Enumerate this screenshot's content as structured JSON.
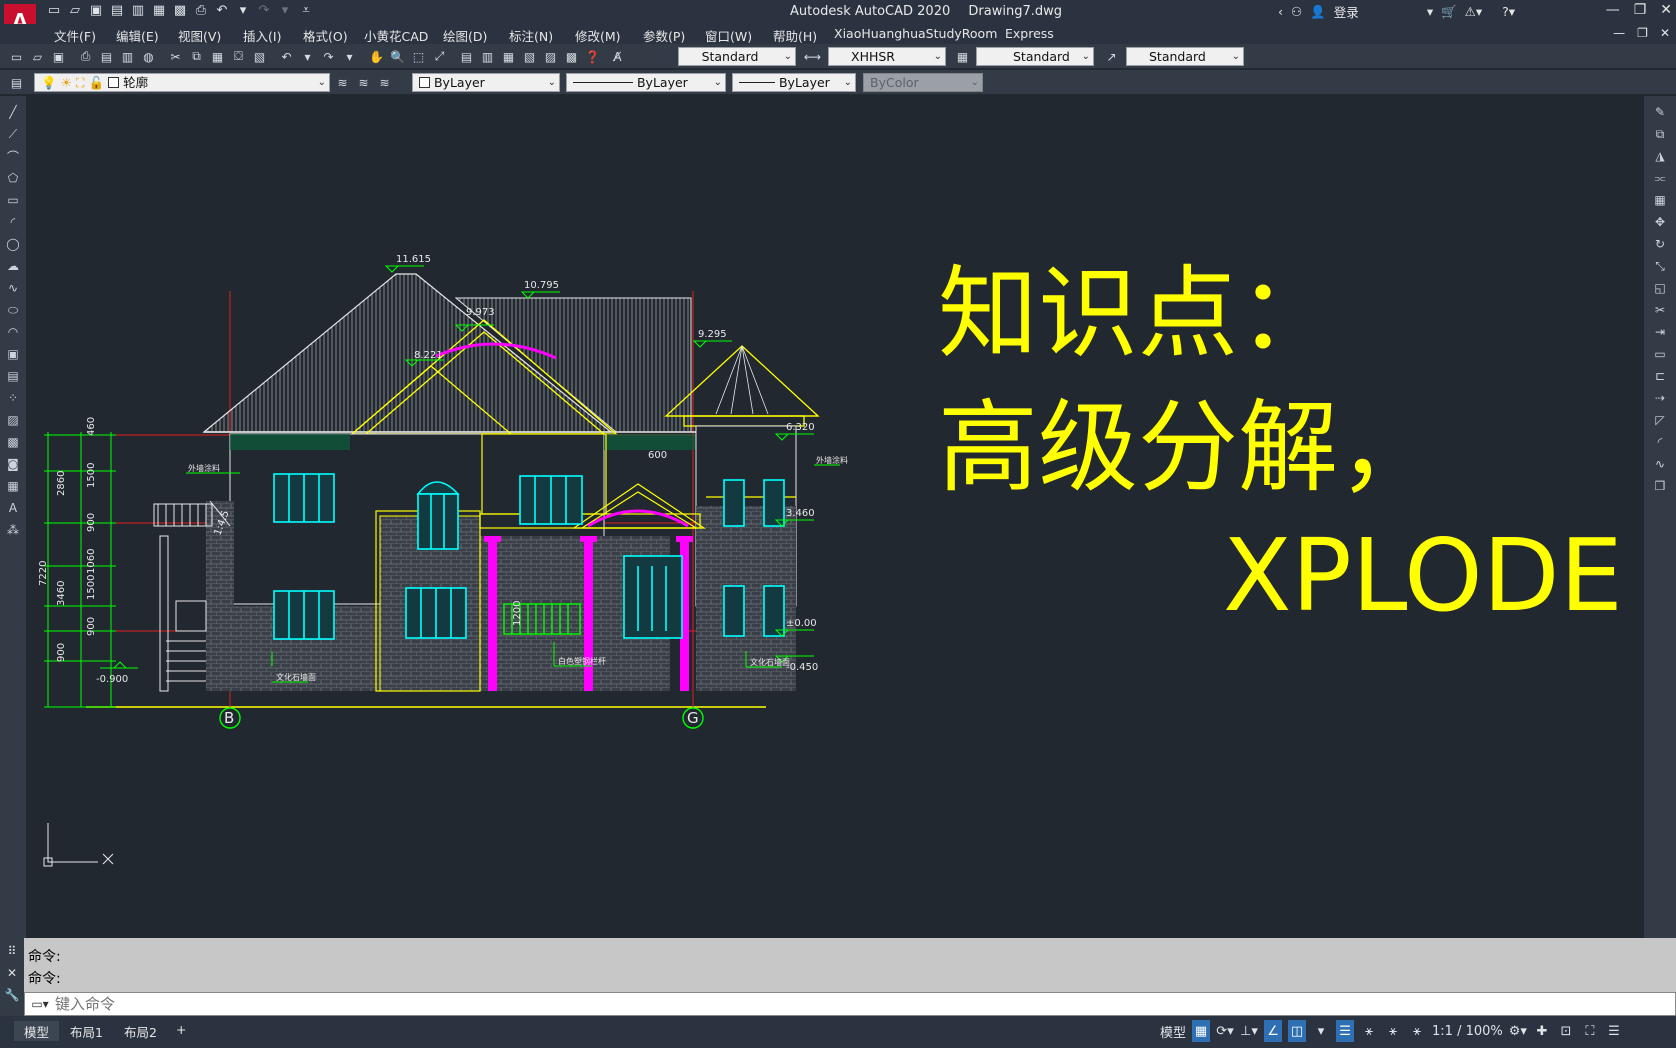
{
  "app": {
    "title": "Autodesk AutoCAD 2020",
    "file": "Drawing7.dwg",
    "logo": "A"
  },
  "top_right": {
    "signin": "登录"
  },
  "menu": [
    "文件(F)",
    "编辑(E)",
    "视图(V)",
    "插入(I)",
    "格式(O)",
    "小黄花CAD",
    "绘图(D)",
    "标注(N)",
    "修改(M)",
    "参数(P)",
    "窗口(W)",
    "帮助(H)",
    "XiaoHuanghuaStudyRoom",
    "Express"
  ],
  "styles_toolbar": {
    "text_style": "Standard",
    "dim_style": "XHHSR",
    "table_style": "Standard",
    "mleader_style": "Standard"
  },
  "layer_toolbar": {
    "layer": "轮廓",
    "color": "ByLayer",
    "linetype": "ByLayer",
    "lineweight": "ByLayer",
    "plotstyle": "ByColor"
  },
  "drawing": {
    "elevations": [
      "11.615",
      "10.795",
      "9.973",
      "9.295",
      "8.221",
      "6.320",
      "3.460",
      "±0.00",
      "-0.450",
      "-0.900"
    ],
    "dims_left": [
      "460",
      "2860",
      "1500",
      "900",
      "1060",
      "1500",
      "3460",
      "900",
      "900",
      "7220"
    ],
    "dim_600": "600",
    "dim_1200": "1200",
    "dim_skew": "1:4.5",
    "axes": [
      "B",
      "G"
    ],
    "labels": [
      "文化石墙面",
      "白色塑钢栏杆",
      "文化石墙面",
      "外墙涂料",
      "外墙涂料"
    ]
  },
  "overlay": {
    "line1": "知识点：",
    "line2": "高级分解，",
    "line3": "XPLODE"
  },
  "command": {
    "history": [
      "命令:",
      "命令:"
    ],
    "placeholder": "键入命令"
  },
  "layout_tabs": [
    "模型",
    "布局1",
    "布局2",
    "+"
  ],
  "status": {
    "model": "模型",
    "scale": "1:1 / 100%"
  },
  "colors": {
    "background": "#212830",
    "overlay_text": "#ffff00",
    "accent": "#2f70b4"
  }
}
